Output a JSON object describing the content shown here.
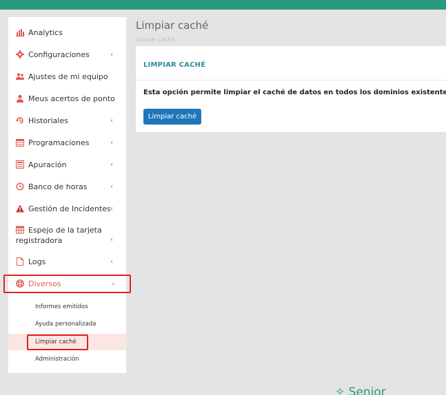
{
  "sidebar": {
    "items": [
      {
        "label": "Analytics",
        "icon": "bar-chart-icon",
        "chevron": false
      },
      {
        "label": "Configuraciones",
        "icon": "gear-icon",
        "chevron": true
      },
      {
        "label": "Ajustes de mi equipo",
        "icon": "users-icon",
        "chevron": false
      },
      {
        "label": "Meus acertos de ponto",
        "icon": "user-icon",
        "chevron": false
      },
      {
        "label": "Historiales",
        "icon": "history-icon",
        "chevron": true
      },
      {
        "label": "Programaciones",
        "icon": "calendar-icon",
        "chevron": true
      },
      {
        "label": "Apuración",
        "icon": "calculator-icon",
        "chevron": true
      },
      {
        "label": "Banco de horas",
        "icon": "clock-icon",
        "chevron": true
      },
      {
        "label": "Gestión de Incidentes",
        "icon": "warning-icon",
        "chevron": true
      },
      {
        "label": "Espejo de la tarjeta registradora",
        "icon": "table-icon",
        "chevron": true
      },
      {
        "label": "Logs",
        "icon": "file-icon",
        "chevron": true
      },
      {
        "label": "Diversos",
        "icon": "lifebuoy-icon",
        "chevron": true,
        "expanded": true
      }
    ],
    "subitems": [
      {
        "label": "Informes emitidos"
      },
      {
        "label": "Ayuda personalizada"
      },
      {
        "label": "Limpiar caché",
        "active": true
      },
      {
        "label": "Administración"
      }
    ]
  },
  "main": {
    "page_title": "Limpiar caché",
    "breadcrumb": "Limpiar caché",
    "card": {
      "title": "LIMPIAR CACHÉ",
      "description": "Esta opción permite limpiar el caché de datos en todos los dominios existentes.",
      "button_label": "Limpiar caché"
    }
  },
  "footer": {
    "logo_text": "Senior"
  },
  "colors": {
    "accent": "#2a9a7c",
    "nav_icon": "#e05a4e",
    "active_text": "#e05a4e",
    "button": "#1f76b8",
    "card_title": "#2a8f94"
  }
}
